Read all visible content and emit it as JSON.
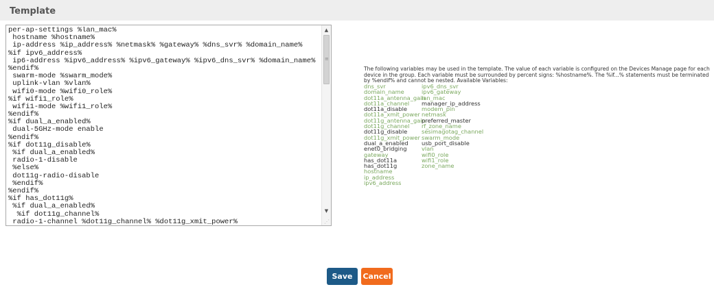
{
  "section": {
    "title": "Template"
  },
  "editor": {
    "lines": [
      "per-ap-settings %lan_mac%",
      " hostname %hostname%",
      " ip-address %ip_address% %netmask% %gateway% %dns_svr% %domain_name%",
      "%if ipv6_address%",
      " ip6-address %ipv6_address% %ipv6_gateway% %ipv6_dns_svr% %domain_name%",
      "%endif%",
      " swarm-mode %swarm_mode%",
      " uplink-vlan %vlan%",
      " wifi0-mode %wifi0_role%",
      "%if wifi1_role%",
      " wifi1-mode %wifi1_role%",
      "%endif%",
      "%if dual_a_enabled%",
      " dual-5GHz-mode enable",
      "%endif%",
      "%if dot11g_disable%",
      " %if dual_a_enabled%",
      " radio-1-disable",
      " %else%",
      " dot11g-radio-disable",
      " %endif%",
      "%endif%",
      "%if has_dot11g%",
      " %if dual_a_enabled%",
      "  %if dot11g_channel%",
      " radio-1-channel %dot11g_channel% %dot11g_xmit_power%"
    ]
  },
  "help": {
    "text": "The following variables may be used in the template. The value of each variable is configured on the Devices Manage page for each device in the group. Each variable must be surrounded by percent signs: %hostname%. The %if...% statements must be terminated by %endif% and cannot be nested. Available Variables:"
  },
  "variables": {
    "column1": [
      {
        "name": "dns_svr",
        "style": "green"
      },
      {
        "name": "domain_name",
        "style": "green"
      },
      {
        "name": "dot11a_antenna_gain",
        "style": "green"
      },
      {
        "name": "dot11a_channel",
        "style": "green"
      },
      {
        "name": "dot11a_disable",
        "style": "dark"
      },
      {
        "name": "dot11a_xmit_power",
        "style": "green"
      },
      {
        "name": "dot11g_antenna_gain",
        "style": "green"
      },
      {
        "name": "dot11g_channel",
        "style": "green"
      },
      {
        "name": "dot11g_disable",
        "style": "dark"
      },
      {
        "name": "dot11g_xmit_power",
        "style": "green"
      },
      {
        "name": "dual_a_enabled",
        "style": "dark"
      },
      {
        "name": "enet0_bridging",
        "style": "dark"
      },
      {
        "name": "gateway",
        "style": "green"
      },
      {
        "name": "has_dot11a",
        "style": "dark"
      },
      {
        "name": "has_dot11g",
        "style": "dark"
      },
      {
        "name": "hostname",
        "style": "green"
      },
      {
        "name": "ip_address",
        "style": "green"
      },
      {
        "name": "ipv6_address",
        "style": "green"
      }
    ],
    "column2": [
      {
        "name": "ipv6_dns_svr",
        "style": "green"
      },
      {
        "name": "ipv6_gateway",
        "style": "green"
      },
      {
        "name": "lan_mac",
        "style": "green"
      },
      {
        "name": "manager_ip_address",
        "style": "dark"
      },
      {
        "name": "modem_pin",
        "style": "green"
      },
      {
        "name": "netmask",
        "style": "green"
      },
      {
        "name": "preferred_master",
        "style": "dark"
      },
      {
        "name": "rf_zone_name",
        "style": "green"
      },
      {
        "name": "sesimagotag_channel",
        "style": "green"
      },
      {
        "name": "swarm_mode",
        "style": "green"
      },
      {
        "name": "usb_port_disable",
        "style": "dark"
      },
      {
        "name": "vlan",
        "style": "green"
      },
      {
        "name": "wifi0_role",
        "style": "green"
      },
      {
        "name": "wifi1_role",
        "style": "green"
      },
      {
        "name": "zone_name",
        "style": "green"
      }
    ]
  },
  "buttons": {
    "save": "Save",
    "cancel": "Cancel"
  },
  "colors": {
    "save": "#1d5a87",
    "cancel": "#f16b1d",
    "variable_green": "#7aa85e",
    "header_bg": "#eeeeee"
  }
}
